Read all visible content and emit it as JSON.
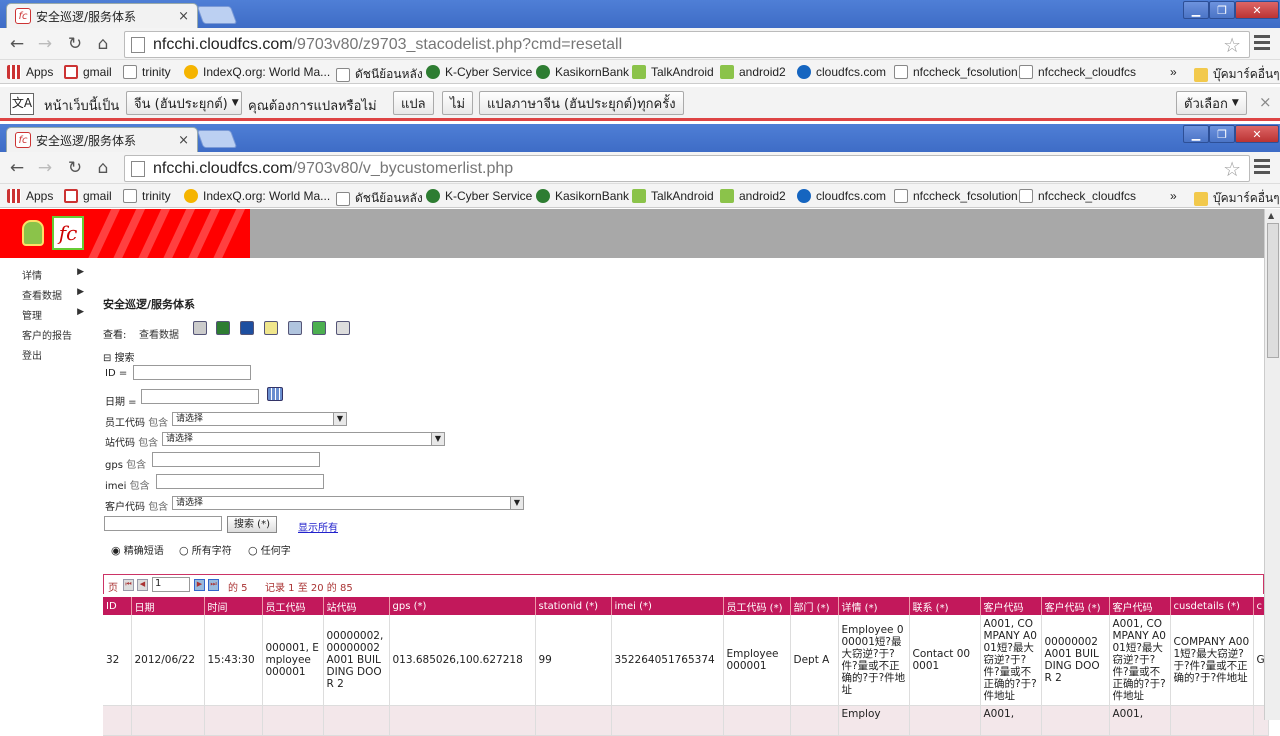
{
  "windows": [
    {
      "tab_title": "安全巡逻/服务体系",
      "url_domain": "nfcchi.cloudfcs.com",
      "url_path": "/9703v80/z9703_stacodelist.php?cmd=resetall"
    },
    {
      "tab_title": "安全巡逻/服务体系",
      "url_domain": "nfcchi.cloudfcs.com",
      "url_path": "/9703v80/v_bycustomerlist.php"
    }
  ],
  "window_controls": {
    "minimize": "▁",
    "maximize": "❐",
    "close": "✕"
  },
  "tab_close": "×",
  "bookmarks": [
    "Apps",
    "gmail",
    "trinity",
    "IndexQ.org: World Ma...",
    "ดัชนีย้อนหลัง",
    "K-Cyber Service",
    "KasikornBank",
    "TalkAndroid",
    "android2",
    "cloudfcs.com",
    "nfccheck_fcsolution",
    "nfccheck_cloudfcs"
  ],
  "bookmarks_more": "»",
  "bookmarks_other": "บุ๊คมาร์คอื่นๆ",
  "translate": {
    "prefix": "หน้าเว็บนี้เป็น",
    "language": "จีน (ฮันประยุกต์)",
    "question": "คุณต้องการแปลหรือไม่",
    "translate_btn": "แปล",
    "no_btn": "ไม่",
    "always_btn": "แปลภาษาจีน (ฮันประยุกต์)ทุกครั้ง",
    "options_btn": "ตัวเลือก",
    "close": "×"
  },
  "sidebar": [
    "详情",
    "查看数据",
    "管理",
    "客户的报告",
    "登出"
  ],
  "heading": "安全巡逻/服务体系",
  "view_label": "查看:",
  "view_data": "查看数据",
  "search": {
    "toggle": "⊟ 搜索",
    "id_label": "ID =",
    "date_label": "日期 =",
    "emp_label": "员工代码",
    "contains": "包含",
    "station_label": "站代码",
    "gps_label": "gps",
    "imei_label": "imei",
    "cust_label": "客户代码",
    "select_placeholder": "请选择",
    "search_btn": "搜索 (*)",
    "show_all": "显示所有",
    "radio_exact": "精确短语",
    "radio_all": "所有字符",
    "radio_any": "任何字"
  },
  "pager": {
    "page_label": "页",
    "page_value": "1",
    "of_text": "的 5",
    "records_text": "记录 1 至 20 的 85"
  },
  "table": {
    "headers": [
      "ID",
      "日期",
      "时间",
      "员工代码",
      "站代码",
      "gps (*)",
      "stationid (*)",
      "imei (*)",
      "员工代码 (*)",
      "部门 (*)",
      "详情 (*)",
      "联系 (*)",
      "客户代码",
      "客户代码 (*)",
      "客户代码",
      "cusdetails (*)",
      "c"
    ],
    "rows": [
      [
        "32",
        "2012/06/22",
        "15:43:30",
        "000001, Employee 000001",
        "00000002, 00000002 A001 BUILDING DOOR 2",
        "013.685026,100.627218",
        "99",
        "352264051765374",
        "Employee 000001",
        "Dept A",
        "Employee 000001短?最大窃逆?于?件?量或不正确的?于?件地址",
        "Contact 000001",
        "A001, COMPANY A001短?最大窃逆?于?件?量或不正确的?于?件地址",
        "00000002 A001 BUILDING DOOR 2",
        "A001, COMPANY A001短?最大窃逆?于?件?量或不正确的?于?件地址",
        "COMPANY A001短?最大窃逆?于?件?量或不正确的?于?件地址",
        "G"
      ],
      [
        "",
        "",
        "",
        "",
        "",
        "",
        "",
        "",
        "",
        "",
        "Employ",
        "",
        "A001,",
        "",
        "A001,",
        "",
        ""
      ]
    ]
  }
}
